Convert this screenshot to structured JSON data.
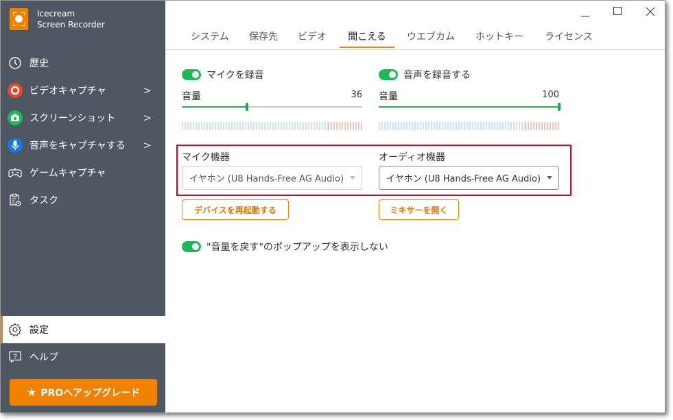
{
  "app": {
    "name_line1": "Icecream",
    "name_line2": "Screen Recorder"
  },
  "sidebar": {
    "items": [
      {
        "id": "history",
        "label": "歴史",
        "icon": "clock-icon"
      },
      {
        "id": "video-capture",
        "label": "ビデオキャプチャ",
        "icon": "record-icon",
        "chevron": ">",
        "color": "#e4472b"
      },
      {
        "id": "screenshot",
        "label": "スクリーンショット",
        "icon": "camera-icon",
        "chevron": ">",
        "color": "#1fb85a"
      },
      {
        "id": "audio-capture",
        "label": "音声をキャプチャする",
        "icon": "microphone-icon",
        "chevron": ">",
        "color": "#1877e0"
      },
      {
        "id": "game-capture",
        "label": "ゲームキャプチャ",
        "icon": "gamepad-icon"
      },
      {
        "id": "tasks",
        "label": "タスク",
        "icon": "task-clipboard-icon"
      }
    ],
    "settings": {
      "label": "設定",
      "icon": "gear-icon",
      "active": true
    },
    "help": {
      "label": "ヘルプ",
      "icon": "help-icon"
    },
    "pro_button": {
      "label": "PROへアップグレード",
      "icon": "star-icon"
    }
  },
  "window_controls": {
    "minimize": "—",
    "maximize": "☐",
    "close": "✕"
  },
  "tabs": [
    {
      "label": "システム"
    },
    {
      "label": "保存先"
    },
    {
      "label": "ビデオ"
    },
    {
      "label": "聞こえる",
      "active": true
    },
    {
      "label": "ウエブカム"
    },
    {
      "label": "ホットキー"
    },
    {
      "label": "ライセンス"
    }
  ],
  "audio": {
    "mic": {
      "toggle_label": "マイクを録音",
      "enabled": true,
      "volume_label": "音量",
      "volume": 36,
      "volume_text": "36",
      "device_label": "マイク機器",
      "device_value": "イヤホン (U8 Hands-Free AG Audio)",
      "button_label": "デバイスを再起動する"
    },
    "system": {
      "toggle_label": "音声を録音する",
      "enabled": true,
      "volume_label": "音量",
      "volume": 100,
      "volume_text": "100",
      "device_label": "オーディオ機器",
      "device_value": "イヤホン (U8 Hands-Free AG Audio)",
      "button_label": "ミキサーを開く"
    },
    "popup_toggle": {
      "label": "\"音量を戻す\"のポップアップを表示しない",
      "enabled": true
    }
  },
  "colors": {
    "accent": "#f08200",
    "toggle_on": "#1db954",
    "sidebar_bg": "#4f5862",
    "highlight_box": "#e0001b"
  }
}
